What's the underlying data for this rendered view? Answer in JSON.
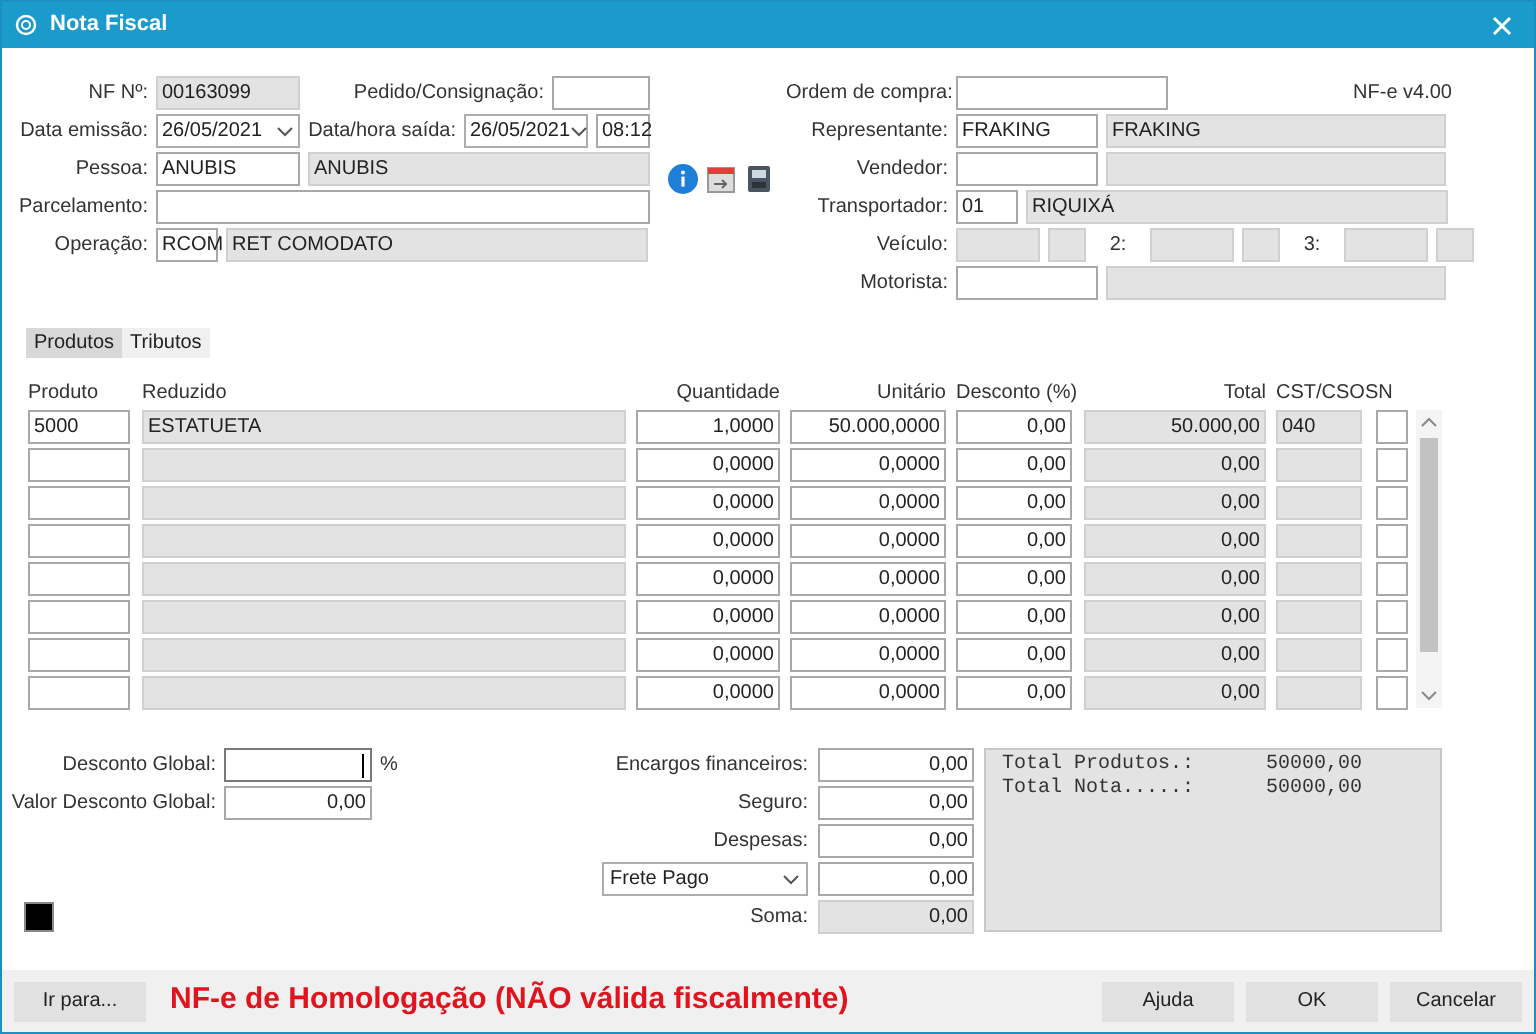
{
  "window": {
    "title": "Nota Fiscal"
  },
  "header_left": [
    {
      "label": "NF Nº:",
      "fields": [
        {
          "kind": "ro",
          "value": "00163099"
        }
      ],
      "extra_label": "Pedido/Consignação:",
      "extra_fields": [
        {
          "kind": "edit"
        }
      ]
    },
    {
      "label": "Data emissão:",
      "fields": [
        {
          "kind": "select",
          "value": "26/05/2021"
        }
      ],
      "extra_label": "Data/hora saída:",
      "extra_fields": [
        {
          "kind": "select",
          "value": "26/05/2021"
        },
        {
          "kind": "edit",
          "value": "08:12"
        }
      ]
    },
    {
      "label": "Pessoa:",
      "fields": [
        {
          "kind": "edit",
          "value": "ANUBIS"
        },
        {
          "kind": "ro",
          "value": "ANUBIS"
        }
      ]
    },
    {
      "label": "Parcelamento:",
      "fields": [
        {
          "kind": "edit"
        }
      ]
    },
    {
      "label": "Operação:",
      "fields": [
        {
          "kind": "edit",
          "value": "RCOM"
        },
        {
          "kind": "ro",
          "value": "RET COMODATO"
        }
      ]
    }
  ],
  "version": "NF-e v4.00",
  "header_right": [
    {
      "label": "Ordem de compra:",
      "fields": [
        {
          "kind": "edit"
        }
      ]
    },
    {
      "label": "Representante:",
      "fields": [
        {
          "kind": "edit",
          "value": "FRAKING"
        },
        {
          "kind": "ro",
          "value": "FRAKING"
        }
      ]
    },
    {
      "label": "Vendedor:",
      "fields": [
        {
          "kind": "edit"
        },
        {
          "kind": "ro"
        }
      ]
    },
    {
      "label": "Transportador:",
      "fields": [
        {
          "kind": "edit",
          "value": "01"
        },
        {
          "kind": "ro",
          "value": "RIQUIXÁ"
        }
      ]
    },
    {
      "label": "Veículo:",
      "fields": [
        {
          "kind": "ro"
        },
        {
          "kind": "ro"
        },
        {
          "kind": "label",
          "value": "2:"
        },
        {
          "kind": "ro"
        },
        {
          "kind": "ro"
        },
        {
          "kind": "label",
          "value": "3:"
        },
        {
          "kind": "ro"
        },
        {
          "kind": "ro"
        }
      ]
    },
    {
      "label": "Motorista:",
      "fields": [
        {
          "kind": "edit"
        },
        {
          "kind": "ro"
        }
      ]
    }
  ],
  "tabs": [
    {
      "label": "Produtos",
      "selected": true
    },
    {
      "label": "Tributos",
      "selected": false
    }
  ],
  "table": {
    "columns": [
      "Produto",
      "Reduzido",
      "Quantidade",
      "Unitário",
      "Desconto (%)",
      "Total",
      "CST/CSOSN"
    ],
    "rows": [
      {
        "produto": "5000",
        "reduzido": "ESTATUETA",
        "quantidade": "1,0000",
        "unitario": "50.000,0000",
        "desconto": "0,00",
        "total": "50.000,00",
        "cst": "040"
      },
      {
        "quantidade": "0,0000",
        "unitario": "0,0000",
        "desconto": "0,00",
        "total": "0,00"
      },
      {
        "quantidade": "0,0000",
        "unitario": "0,0000",
        "desconto": "0,00",
        "total": "0,00"
      },
      {
        "quantidade": "0,0000",
        "unitario": "0,0000",
        "desconto": "0,00",
        "total": "0,00"
      },
      {
        "quantidade": "0,0000",
        "unitario": "0,0000",
        "desconto": "0,00",
        "total": "0,00"
      },
      {
        "quantidade": "0,0000",
        "unitario": "0,0000",
        "desconto": "0,00",
        "total": "0,00"
      },
      {
        "quantidade": "0,0000",
        "unitario": "0,0000",
        "desconto": "0,00",
        "total": "0,00"
      },
      {
        "quantidade": "0,0000",
        "unitario": "0,0000",
        "desconto": "0,00",
        "total": "0,00"
      }
    ]
  },
  "discount": {
    "global_label": "Desconto Global:",
    "percent": "%",
    "value_label": "Valor Desconto Global:",
    "value": "0,00"
  },
  "charges": [
    {
      "label": "Encargos financeiros:",
      "value": "0,00",
      "kind": "edit"
    },
    {
      "label": "Seguro:",
      "value": "0,00",
      "kind": "edit"
    },
    {
      "label": "Despesas:",
      "value": "0,00",
      "kind": "edit"
    },
    {
      "select": "Frete Pago",
      "value": "0,00",
      "kind": "edit"
    },
    {
      "label": "Soma:",
      "value": "0,00",
      "kind": "ro"
    }
  ],
  "summary": [
    "Total Produtos.:      50000,00",
    "Total Nota.....:      50000,00"
  ],
  "footer": {
    "goto": "Ir para...",
    "warning": "NF-e de Homologação (NÃO válida fiscalmente)",
    "buttons": [
      "Ajuda",
      "OK",
      "Cancelar"
    ]
  }
}
